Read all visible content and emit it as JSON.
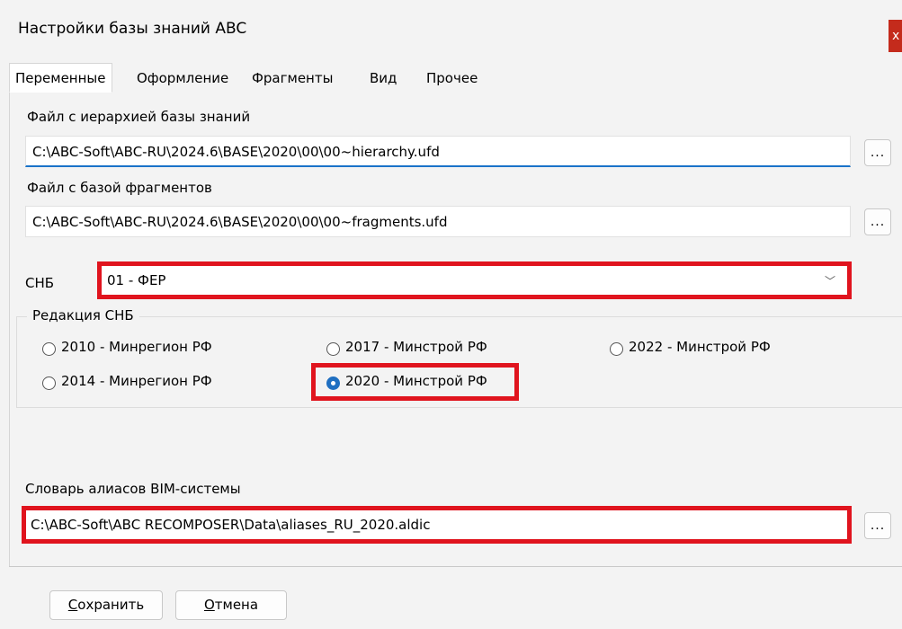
{
  "window": {
    "title": "Настройки базы знаний ABC",
    "close_glyph": "x"
  },
  "tabs": [
    {
      "label": "Переменные",
      "active": true
    },
    {
      "label": "Оформление",
      "active": false
    },
    {
      "label": "Фрагменты",
      "active": false
    },
    {
      "label": "Вид",
      "active": false
    },
    {
      "label": "Прочее",
      "active": false
    }
  ],
  "hierarchy": {
    "label": "Файл с иерархией базы знаний",
    "value": "C:\\ABC-Soft\\ABC-RU\\2024.6\\BASE\\2020\\00\\00~hierarchy.ufd",
    "browse_label": "..."
  },
  "fragments": {
    "label": "Файл с базой фрагментов",
    "value": "C:\\ABC-Soft\\ABC-RU\\2024.6\\BASE\\2020\\00\\00~fragments.ufd",
    "browse_label": "..."
  },
  "snb": {
    "label": "СНБ",
    "selected": "01 - ФЕР",
    "chevron": "﹀"
  },
  "edition": {
    "group_label": "Редакция СНБ",
    "options": [
      {
        "label": "2010 - Минрегион РФ",
        "checked": false
      },
      {
        "label": "2017 - Минстрой РФ",
        "checked": false
      },
      {
        "label": "2022 - Минстрой РФ",
        "checked": false
      },
      {
        "label": "2014 - Минрегион РФ",
        "checked": false
      },
      {
        "label": "2020 - Минстрой РФ",
        "checked": true
      }
    ]
  },
  "aliases": {
    "label": "Словарь алиасов BIM-системы",
    "value": "C:\\ABC-Soft\\ABC RECOMPOSER\\Data\\aliases_RU_2020.aldic",
    "browse_label": "..."
  },
  "buttons": {
    "save_first": "С",
    "save_rest": "охранить",
    "cancel_first": "О",
    "cancel_rest": "тмена"
  },
  "colors": {
    "highlight": "#e0141e",
    "accent": "#1f6fc1",
    "close": "#c42b1c"
  }
}
